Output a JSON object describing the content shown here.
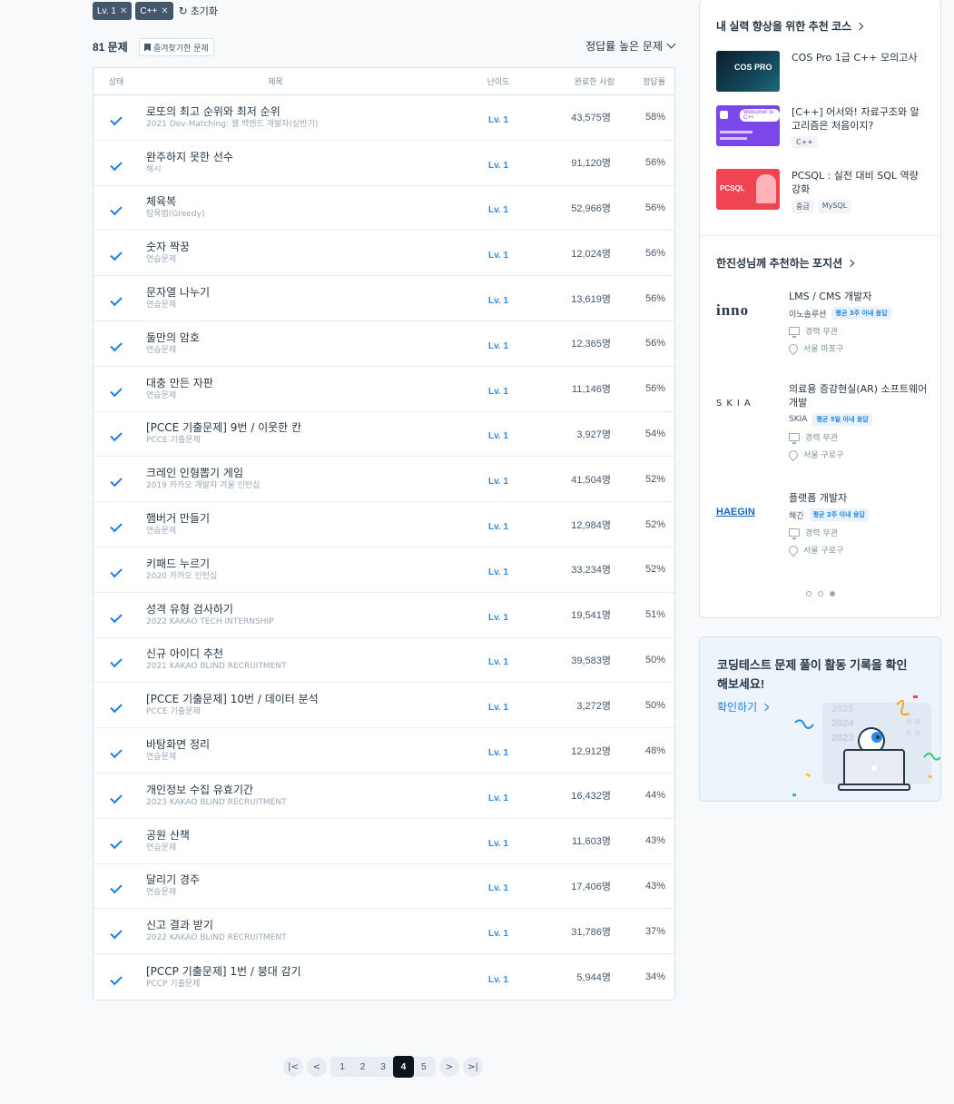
{
  "filters": {
    "chips": [
      "Lv. 1",
      "C++"
    ],
    "reset_label": "초기화"
  },
  "list_header": {
    "count": "81 문제",
    "favorites_label": "즐겨찾기한 문제",
    "sort_label": "정답률 높은 문제"
  },
  "table": {
    "columns": [
      "상태",
      "제목",
      "난이도",
      "완료한 사람",
      "정답률"
    ],
    "rows": [
      {
        "title": "로또의 최고 순위와 최저 순위",
        "category": "2021 Dev-Matching: 웹 백엔드 개발자(상반기)",
        "level": "Lv. 1",
        "completed": "43,575명",
        "rate": "58%"
      },
      {
        "title": "완주하지 못한 선수",
        "category": "해시",
        "level": "Lv. 1",
        "completed": "91,120명",
        "rate": "56%"
      },
      {
        "title": "체육복",
        "category": "탐욕법(Greedy)",
        "level": "Lv. 1",
        "completed": "52,966명",
        "rate": "56%"
      },
      {
        "title": "숫자 짝꿍",
        "category": "연습문제",
        "level": "Lv. 1",
        "completed": "12,024명",
        "rate": "56%"
      },
      {
        "title": "문자열 나누기",
        "category": "연습문제",
        "level": "Lv. 1",
        "completed": "13,619명",
        "rate": "56%"
      },
      {
        "title": "둘만의 암호",
        "category": "연습문제",
        "level": "Lv. 1",
        "completed": "12,365명",
        "rate": "56%"
      },
      {
        "title": "대충 만든 자판",
        "category": "연습문제",
        "level": "Lv. 1",
        "completed": "11,146명",
        "rate": "56%"
      },
      {
        "title": "[PCCE 기출문제] 9번 / 이웃한 칸",
        "category": "PCCE 기출문제",
        "level": "Lv. 1",
        "completed": "3,927명",
        "rate": "54%"
      },
      {
        "title": "크레인 인형뽑기 게임",
        "category": "2019 카카오 개발자 겨울 인턴십",
        "level": "Lv. 1",
        "completed": "41,504명",
        "rate": "52%"
      },
      {
        "title": "햄버거 만들기",
        "category": "연습문제",
        "level": "Lv. 1",
        "completed": "12,984명",
        "rate": "52%"
      },
      {
        "title": "키패드 누르기",
        "category": "2020 카카오 인턴십",
        "level": "Lv. 1",
        "completed": "33,234명",
        "rate": "52%"
      },
      {
        "title": "성격 유형 검사하기",
        "category": "2022 KAKAO TECH INTERNSHIP",
        "level": "Lv. 1",
        "completed": "19,541명",
        "rate": "51%"
      },
      {
        "title": "신규 아이디 추천",
        "category": "2021 KAKAO BLIND RECRUITMENT",
        "level": "Lv. 1",
        "completed": "39,583명",
        "rate": "50%"
      },
      {
        "title": "[PCCE 기출문제] 10번 / 데이터 분석",
        "category": "PCCE 기출문제",
        "level": "Lv. 1",
        "completed": "3,272명",
        "rate": "50%"
      },
      {
        "title": "바탕화면 정리",
        "category": "연습문제",
        "level": "Lv. 1",
        "completed": "12,912명",
        "rate": "48%"
      },
      {
        "title": "개인정보 수집 유효기간",
        "category": "2023 KAKAO BLIND RECRUITMENT",
        "level": "Lv. 1",
        "completed": "16,432명",
        "rate": "44%"
      },
      {
        "title": "공원 산책",
        "category": "연습문제",
        "level": "Lv. 1",
        "completed": "11,603명",
        "rate": "43%"
      },
      {
        "title": "달리기 경주",
        "category": "연습문제",
        "level": "Lv. 1",
        "completed": "17,406명",
        "rate": "43%"
      },
      {
        "title": "신고 결과 받기",
        "category": "2022 KAKAO BLIND RECRUITMENT",
        "level": "Lv. 1",
        "completed": "31,786명",
        "rate": "37%"
      },
      {
        "title": "[PCCP 기출문제] 1번 / 붕대 감기",
        "category": "PCCP 기출문제",
        "level": "Lv. 1",
        "completed": "5,944명",
        "rate": "34%"
      }
    ]
  },
  "pagination": {
    "pages": [
      "1",
      "2",
      "3",
      "4",
      "5"
    ],
    "current": "4"
  },
  "courses": {
    "heading": "내 실력 향상을 위한 추천 코스",
    "items": [
      {
        "title": "COS Pro 1급 C++ 모의고사",
        "tags": [],
        "thumb_text": "COS PRO"
      },
      {
        "title": "[C++] 어서와! 자료구조와 알고리즘은 처음이지?",
        "tags": [
          "C++"
        ],
        "thumb_text": "Welcome! to C++"
      },
      {
        "title": "PCSQL : 실전 대비 SQL 역량 강화",
        "tags": [
          "중급",
          "MySQL"
        ],
        "thumb_text": "PCSQL"
      }
    ]
  },
  "positions": {
    "heading": "한진성님께 추천하는 포지션",
    "items": [
      {
        "logo": "inno",
        "title": "LMS / CMS 개발자",
        "company": "이노솔루션",
        "badge": "평균 3주 이내 응답",
        "career": "경력 무관",
        "location": "서울 마포구"
      },
      {
        "logo": "SKIA",
        "title": "의료용 증강현실(AR) 소프트웨어 개발",
        "company": "SKIA",
        "badge": "평균 5일 이내 응답",
        "career": "경력 무관",
        "location": "서울 구로구"
      },
      {
        "logo": "HAEGIN",
        "title": "플랫폼 개발자",
        "company": "해긴",
        "badge": "평균 2주 이내 응답",
        "career": "경력 무관",
        "location": "서울 구로구"
      }
    ]
  },
  "activity": {
    "title": "코딩테스트 문제 풀이 활동 기록을 확인해보세요!",
    "link_label": "확인하기",
    "illustration_years": [
      "2025",
      "2024",
      "2023"
    ]
  },
  "colors": {
    "accent": "#1e7fe0",
    "chip_bg": "#44576c",
    "page_active": "#0c151c"
  }
}
